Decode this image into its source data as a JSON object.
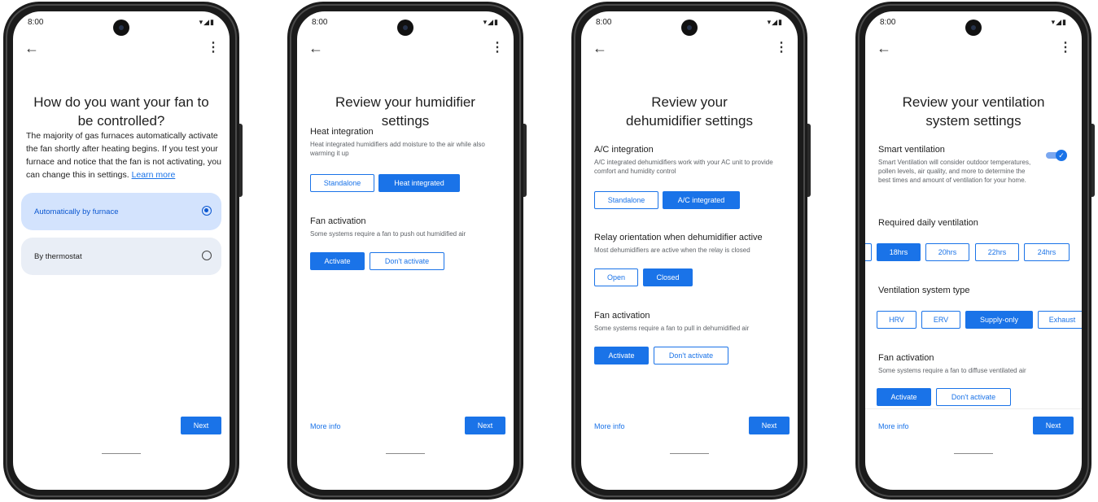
{
  "common": {
    "time": "8:00",
    "status_icons": "▾◢▮",
    "back": "←",
    "menu": "⋮",
    "next_label": "Next",
    "more_info_label": "More info"
  },
  "phone1": {
    "title": "How do you want your fan to be controlled?",
    "body_text": "The majority of gas furnaces automatically activate the fan shortly after heating begins. If you test your furnace and notice that the fan is not activating, you can change this in settings.",
    "learn_more": "Learn more",
    "options": [
      {
        "label": "Automatically by furnace",
        "selected": true
      },
      {
        "label": "By thermostat",
        "selected": false
      }
    ]
  },
  "phone2": {
    "title": "Review your humidifier settings",
    "sections": [
      {
        "title": "Heat integration",
        "description": "Heat integrated humidifiers add moisture to the air while also warming it up",
        "buttons": [
          {
            "label": "Standalone",
            "selected": false
          },
          {
            "label": "Heat integrated",
            "selected": true
          }
        ]
      },
      {
        "title": "Fan activation",
        "description": "Some systems require a fan to push out humidified air",
        "buttons": [
          {
            "label": "Activate",
            "selected": true
          },
          {
            "label": "Don't activate",
            "selected": false
          }
        ]
      }
    ]
  },
  "phone3": {
    "title": "Review your dehumidifier settings",
    "sections": [
      {
        "title": "A/C integration",
        "description": "A/C integrated dehumidifiers work with your AC unit to provide comfort and humidity control",
        "buttons": [
          {
            "label": "Standalone",
            "selected": false
          },
          {
            "label": "A/C integrated",
            "selected": true
          }
        ]
      },
      {
        "title": "Relay orientation when dehumidifier active",
        "description": "Most dehumidifiers are active when the relay is closed",
        "buttons": [
          {
            "label": "Open",
            "selected": false
          },
          {
            "label": "Closed",
            "selected": true
          }
        ]
      },
      {
        "title": "Fan activation",
        "description": "Some systems require a fan to pull in dehumidified air",
        "buttons": [
          {
            "label": "Activate",
            "selected": true
          },
          {
            "label": "Don't activate",
            "selected": false
          }
        ]
      }
    ]
  },
  "phone4": {
    "title": "Review your ventilation system settings",
    "smart_ventilation": {
      "title": "Smart ventilation",
      "description": "Smart Ventilation will consider outdoor temperatures, pollen levels, air quality, and more to determine the best times and amount of ventilation for your home.",
      "enabled": true,
      "check": "✓"
    },
    "daily_ventilation": {
      "title": "Required daily ventilation",
      "options": [
        {
          "label": "",
          "selected": false
        },
        {
          "label": "18hrs",
          "selected": true
        },
        {
          "label": "20hrs",
          "selected": false
        },
        {
          "label": "22hrs",
          "selected": false
        },
        {
          "label": "24hrs",
          "selected": false
        }
      ]
    },
    "system_type": {
      "title": "Ventilation system type",
      "options": [
        {
          "label": "HRV",
          "selected": false
        },
        {
          "label": "ERV",
          "selected": false
        },
        {
          "label": "Supply-only",
          "selected": true
        },
        {
          "label": "Exhaust",
          "selected": false
        }
      ]
    },
    "fan_activation": {
      "title": "Fan activation",
      "description": "Some systems require a fan to diffuse ventilated air",
      "buttons": [
        {
          "label": "Activate",
          "selected": true
        },
        {
          "label": "Don't activate",
          "selected": false
        }
      ]
    }
  }
}
